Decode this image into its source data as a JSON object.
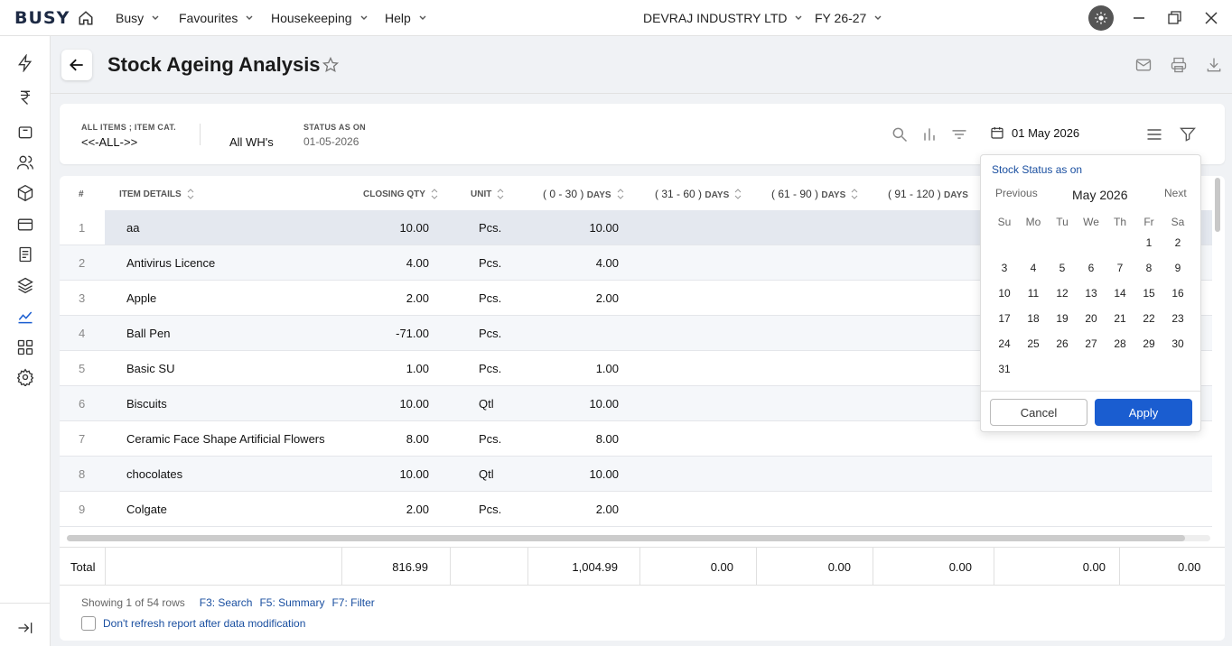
{
  "topbar": {
    "logo": "BUSY",
    "menus": [
      "Busy",
      "Favourites",
      "Housekeeping",
      "Help"
    ],
    "company": "DEVRAJ INDUSTRY LTD",
    "fy": "FY 26-27"
  },
  "page": {
    "title": "Stock Ageing Analysis"
  },
  "filters": {
    "items_caption": "ALL ITEMS ; ITEM CAT.",
    "items_value": "<<-ALL->>",
    "warehouse": "All WH's",
    "status_caption": "STATUS AS ON",
    "status_date": "01-05-2026",
    "date_value": "01 May 2026"
  },
  "table": {
    "headers": {
      "idx": "#",
      "item": "ITEM DETAILS",
      "qty": "CLOSING QTY",
      "unit": "UNIT",
      "d0_30": "( 0 - 30 )",
      "d31_60": "( 31 - 60 )",
      "d61_90": "( 61 - 90 )",
      "d91_120": "( 91 - 120 )",
      "days_suffix": "DAYS"
    },
    "rows": [
      {
        "n": "1",
        "item": "aa",
        "qty": "10.00",
        "unit": "Pcs.",
        "d0": "10.00"
      },
      {
        "n": "2",
        "item": "Antivirus Licence",
        "qty": "4.00",
        "unit": "Pcs.",
        "d0": "4.00"
      },
      {
        "n": "3",
        "item": "Apple",
        "qty": "2.00",
        "unit": "Pcs.",
        "d0": "2.00"
      },
      {
        "n": "4",
        "item": "Ball Pen",
        "qty": "-71.00",
        "unit": "Pcs.",
        "d0": ""
      },
      {
        "n": "5",
        "item": "Basic SU",
        "qty": "1.00",
        "unit": "Pcs.",
        "d0": "1.00"
      },
      {
        "n": "6",
        "item": "Biscuits",
        "qty": "10.00",
        "unit": "Qtl",
        "d0": "10.00"
      },
      {
        "n": "7",
        "item": "Ceramic Face Shape Artificial Flowers",
        "qty": "8.00",
        "unit": "Pcs.",
        "d0": "8.00"
      },
      {
        "n": "8",
        "item": "chocolates",
        "qty": "10.00",
        "unit": "Qtl",
        "d0": "10.00"
      },
      {
        "n": "9",
        "item": "Colgate",
        "qty": "2.00",
        "unit": "Pcs.",
        "d0": "2.00"
      }
    ],
    "total": {
      "label": "Total",
      "qty": "816.99",
      "d0": "1,004.99",
      "d31": "0.00",
      "d61": "0.00",
      "d91": "0.00",
      "d121": "0.00",
      "d_last": "0.00"
    }
  },
  "footer": {
    "showing": "Showing 1 of 54 rows",
    "f3": "F3: Search",
    "f5": "F5: Summary",
    "f7": "F7: Filter",
    "refresh_label": "Don't refresh report after data modification"
  },
  "calendar": {
    "title": "Stock Status as on",
    "prev": "Previous",
    "next": "Next",
    "month": "May 2026",
    "weekdays": [
      "Su",
      "Mo",
      "Tu",
      "We",
      "Th",
      "Fr",
      "Sa"
    ],
    "days": [
      "1",
      "2",
      "3",
      "4",
      "5",
      "6",
      "7",
      "8",
      "9",
      "10",
      "11",
      "12",
      "13",
      "14",
      "15",
      "16",
      "17",
      "18",
      "19",
      "20",
      "21",
      "22",
      "23",
      "24",
      "25",
      "26",
      "27",
      "28",
      "29",
      "30",
      "31"
    ],
    "cancel": "Cancel",
    "apply": "Apply"
  }
}
